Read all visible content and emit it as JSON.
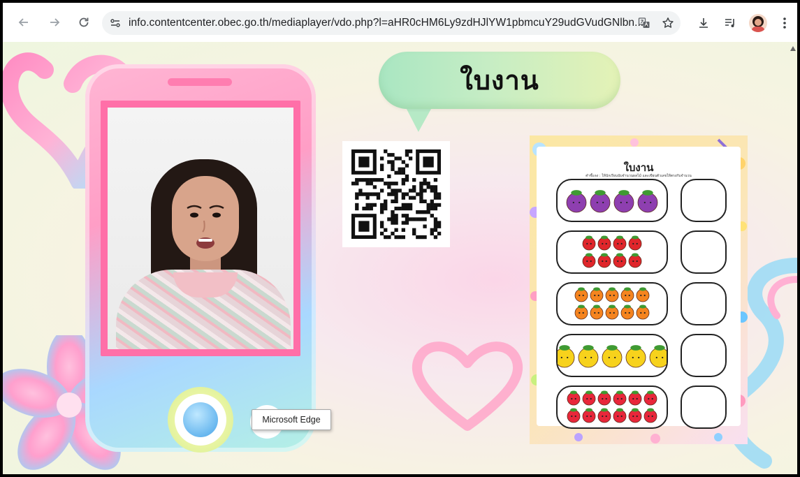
{
  "browser": {
    "url": "info.contentcenter.obec.go.th/mediaplayer/vdo.php?l=aHR0cHM6Ly9zdHJlYW1pbmcuY29udGVudGNlbn..."
  },
  "slide": {
    "title": "ใบงาน"
  },
  "worksheet": {
    "title": "ใบงาน",
    "instruction": "คำชี้แจง : ให้นักเรียนนับจำนวนผลไม้ และเขียนตัวเลขให้ตรงกับจำนวน",
    "rows": [
      {
        "fruit": "grape",
        "count": 4,
        "color": "#8e3fb0"
      },
      {
        "fruit": "apple",
        "count": 8,
        "color": "#e0262b"
      },
      {
        "fruit": "orange",
        "count": 10,
        "color": "#f5841f"
      },
      {
        "fruit": "pineapple",
        "count": 5,
        "color": "#f7d21c"
      },
      {
        "fruit": "strawberry",
        "count": 12,
        "color": "#e8273a"
      }
    ]
  },
  "tooltip": {
    "text": "Microsoft Edge"
  }
}
